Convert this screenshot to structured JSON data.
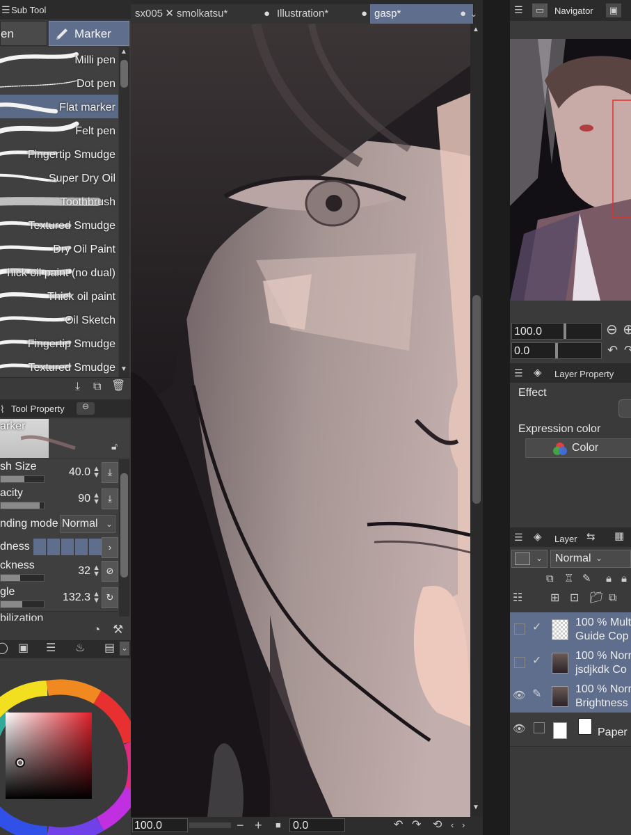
{
  "subtool": {
    "title": "Sub Tool",
    "tab_pen": "en",
    "tab_marker": "Marker",
    "brushes": [
      {
        "label": "Milli pen",
        "selected": false
      },
      {
        "label": "Dot pen",
        "selected": false
      },
      {
        "label": "Flat marker",
        "selected": true
      },
      {
        "label": "Felt pen",
        "selected": false
      },
      {
        "label": "Fingertip Smudge",
        "selected": false
      },
      {
        "label": "Super Dry Oil",
        "selected": false
      },
      {
        "label": "Toothbrush",
        "selected": false
      },
      {
        "label": "Textured Smudge",
        "selected": false
      },
      {
        "label": "Dry Oil Paint",
        "selected": false
      },
      {
        "label": "hick oil paint (no dual)",
        "selected": false
      },
      {
        "label": "Thick oil paint",
        "selected": false
      },
      {
        "label": "Oil Sketch",
        "selected": false
      },
      {
        "label": "Fingertip Smudge",
        "selected": false
      },
      {
        "label": "Textured Smudge",
        "selected": false
      }
    ]
  },
  "toolprop": {
    "title": "Tool Property",
    "preview_label": "arker",
    "brush_size_label": "sh Size",
    "brush_size_value": "40.0",
    "opacity_label": "acity",
    "opacity_value": "90",
    "blending_label": "nding mode",
    "blending_value": "Normal",
    "hardness_label": "dness",
    "thickness_label": "ckness",
    "thickness_value": "32",
    "angle_label": "gle",
    "angle_value": "132.3",
    "stabilization_label": "bilization",
    "brush_size_fill": 0.55,
    "opacity_fill": 0.9,
    "thickness_fill": 0.45,
    "angle_fill": 0.5
  },
  "tabs": [
    {
      "label": "sx005",
      "close": "✕",
      "active": false
    },
    {
      "label": "smolkatsu*",
      "close": "●",
      "active": false
    },
    {
      "label": "Illustration*",
      "close": "●",
      "active": false
    },
    {
      "label": "gasp*",
      "close": "●",
      "active": true
    }
  ],
  "statusbar": {
    "zoom": "100.0",
    "rotation": "0.0",
    "minus": "−",
    "plus": "+"
  },
  "navigator": {
    "title": "Navigator",
    "zoom": "100.0",
    "rotation": "0.0"
  },
  "layerprop": {
    "title": "Layer Property",
    "effect_label": "Effect",
    "expression_label": "Expression color",
    "expression_value": "Color"
  },
  "layers": {
    "title": "Layer",
    "blend_mode": "Normal",
    "items": [
      {
        "line1": "100 % Mult",
        "line2": "Guide Cop",
        "visible": false,
        "checked": true,
        "selected": true
      },
      {
        "line1": "100 % Norn",
        "line2": "jsdjkdk Co",
        "visible": false,
        "checked": true,
        "selected": true
      },
      {
        "line1": "100 % Norn",
        "line2": "Brightness",
        "visible": true,
        "checked": false,
        "selected": true
      },
      {
        "line1": "",
        "line2": "Paper",
        "visible": true,
        "checked": false,
        "selected": false
      }
    ]
  },
  "colors": {
    "accent": "#5e6e8c",
    "panel": "#3a3a3a",
    "header": "#2b2b2b",
    "canvas_dark": "#1e1a1e",
    "skin": "#b9a3a1"
  },
  "icons": [
    "pen-icon",
    "marker-icon",
    "trash-icon",
    "eye-icon",
    "check-icon",
    "pencil-icon",
    "lock-icon",
    "folder-icon"
  ]
}
